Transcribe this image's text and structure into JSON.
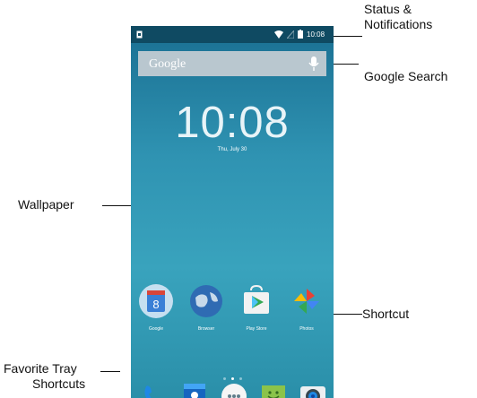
{
  "callouts": {
    "status_line1": "Status &",
    "status_line2": "Notifications",
    "google_search": "Google Search",
    "wallpaper": "Wallpaper",
    "shortcut": "Shortcut",
    "favorite_line1": "Favorite Tray",
    "favorite_line2": "Shortcuts"
  },
  "status_bar": {
    "time": "10:08"
  },
  "search": {
    "brand": "Google"
  },
  "lockscreen": {
    "clock": "10:08",
    "date": "Thu, July 30"
  },
  "home_apps": [
    {
      "label": "Google",
      "icon": "google-app-icon"
    },
    {
      "label": "Browser",
      "icon": "globe-icon"
    },
    {
      "label": "Play Store",
      "icon": "play-store-icon"
    },
    {
      "label": "Photos",
      "icon": "pinwheel-icon"
    }
  ],
  "pager": {
    "pages": 3,
    "current": 2
  },
  "favorite_tray": [
    "phone-icon",
    "contacts-icon",
    "app-drawer-icon",
    "messaging-icon",
    "camera-icon"
  ],
  "colors": {
    "wallpaper_top": "#1a6f92",
    "wallpaper_mid": "#39a3bd",
    "statusbar": "#0f4a62",
    "searchbar": "#b9c7cf"
  }
}
